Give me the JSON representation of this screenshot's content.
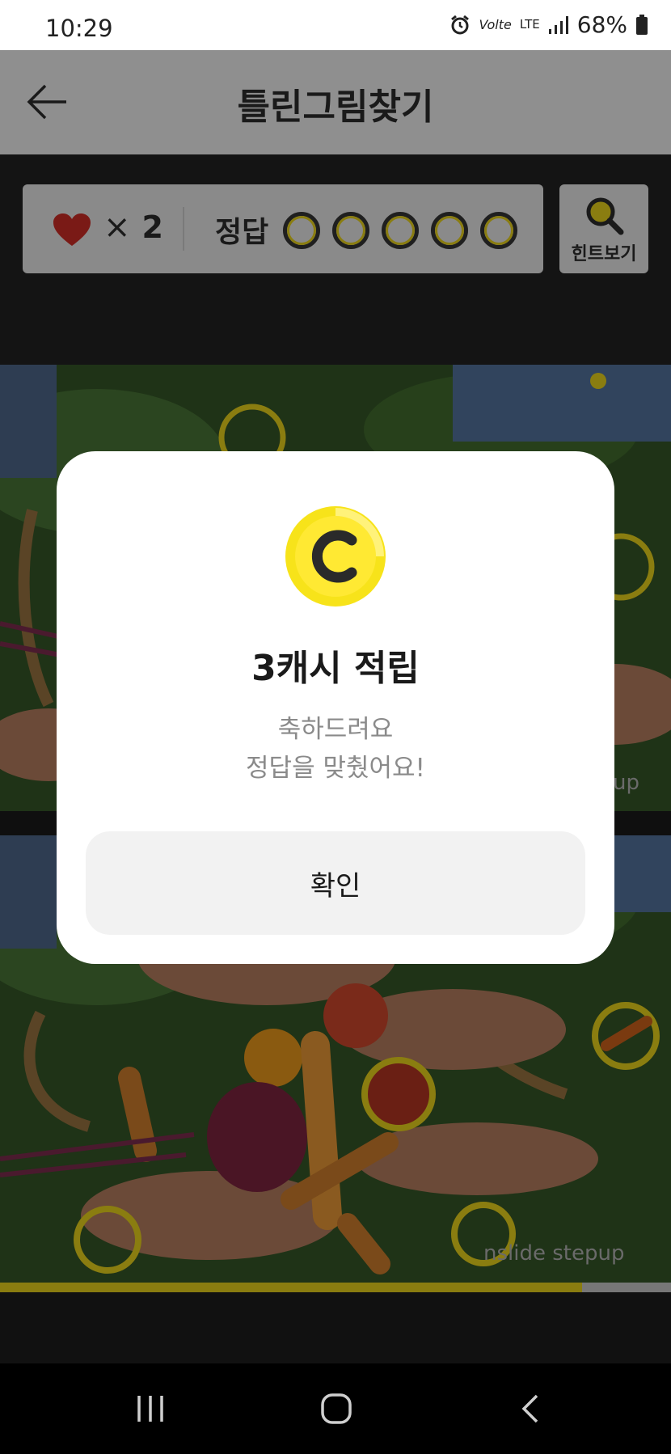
{
  "status_bar": {
    "time": "10:29",
    "volte": "Volte",
    "lte": "LTE",
    "battery": "68%"
  },
  "header": {
    "title": "틀린그림찾기"
  },
  "score": {
    "lives": "2",
    "multiplier": "×",
    "answer_label": "정답",
    "found": 0,
    "total": 5
  },
  "hint": {
    "label": "힌트보기"
  },
  "modal": {
    "title": "3캐시 적립",
    "line1": "축하드려요",
    "line2": "정답을 맞췄어요!",
    "confirm_label": "확인"
  },
  "watermark": {
    "top": "up",
    "bottom": "nslide stepup"
  },
  "progress": {
    "fraction": 0.867
  },
  "colors": {
    "accent": "#f5d800",
    "dim_accent": "#8a7d10",
    "heart": "#e0261f",
    "dim_heart": "#7a1a16"
  }
}
